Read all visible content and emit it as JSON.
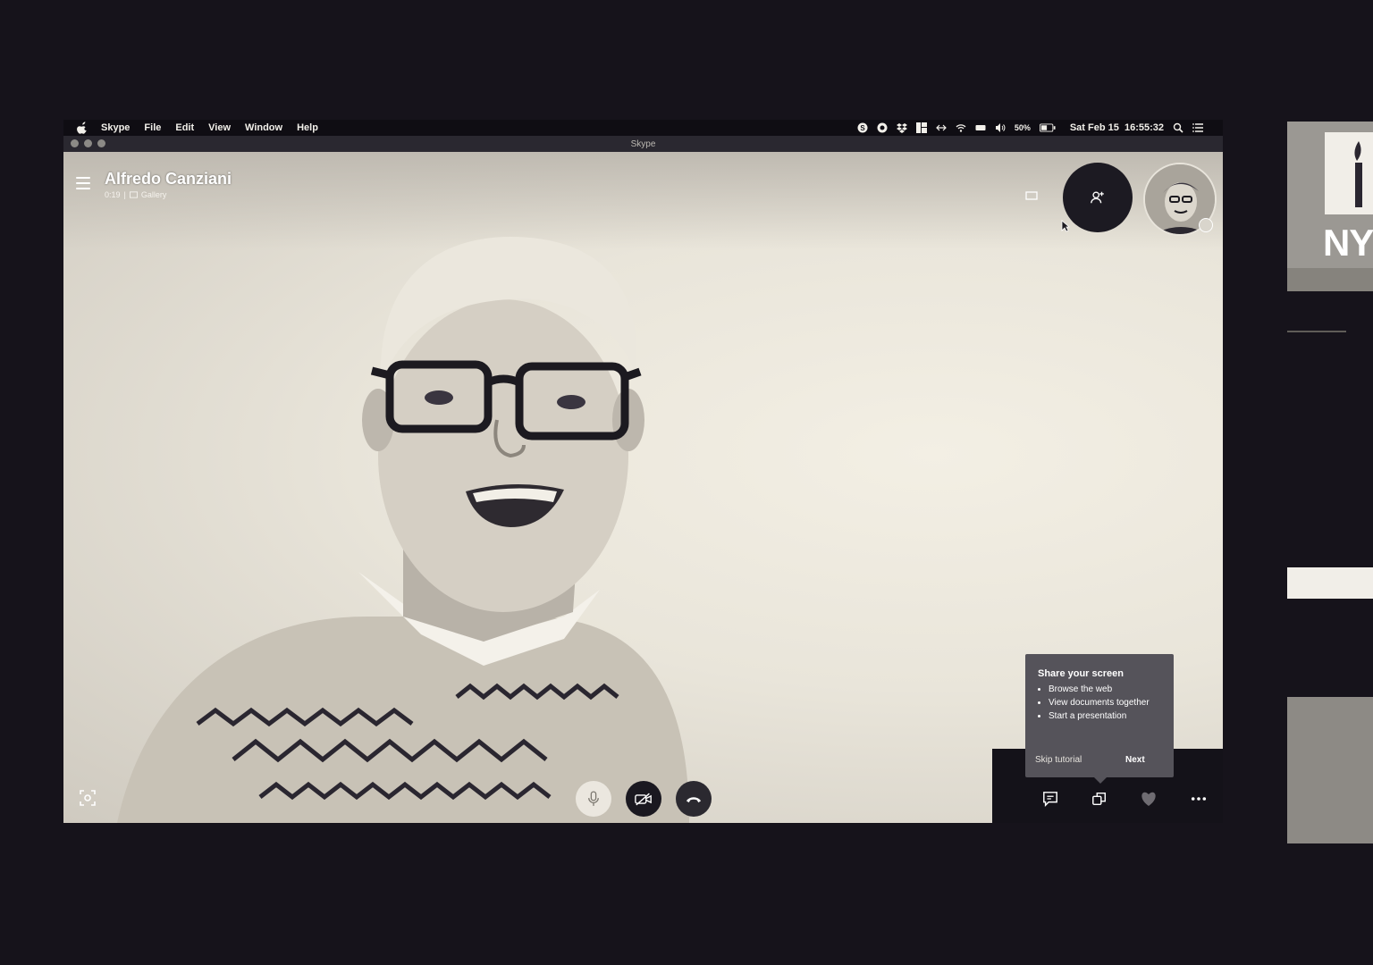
{
  "menubar": {
    "app_name": "Skype",
    "menus": [
      "File",
      "Edit",
      "View",
      "Window",
      "Help"
    ],
    "battery": "50%",
    "datetime": "Sat Feb 15  16:55:32"
  },
  "window": {
    "title": "Skype"
  },
  "call": {
    "caller_name": "Alfredo Canziani",
    "duration": "0:19",
    "view_mode": "Gallery"
  },
  "tutorial": {
    "title": "Share your screen",
    "items": [
      "Browse the web",
      "View documents together",
      "Start a presentation"
    ],
    "skip_label": "Skip tutorial",
    "next_label": "Next"
  },
  "side_window": {
    "partial_text": "NY"
  },
  "colors": {
    "background": "#16131b",
    "popup": "#55535a",
    "video_light": "#f3efe4"
  }
}
